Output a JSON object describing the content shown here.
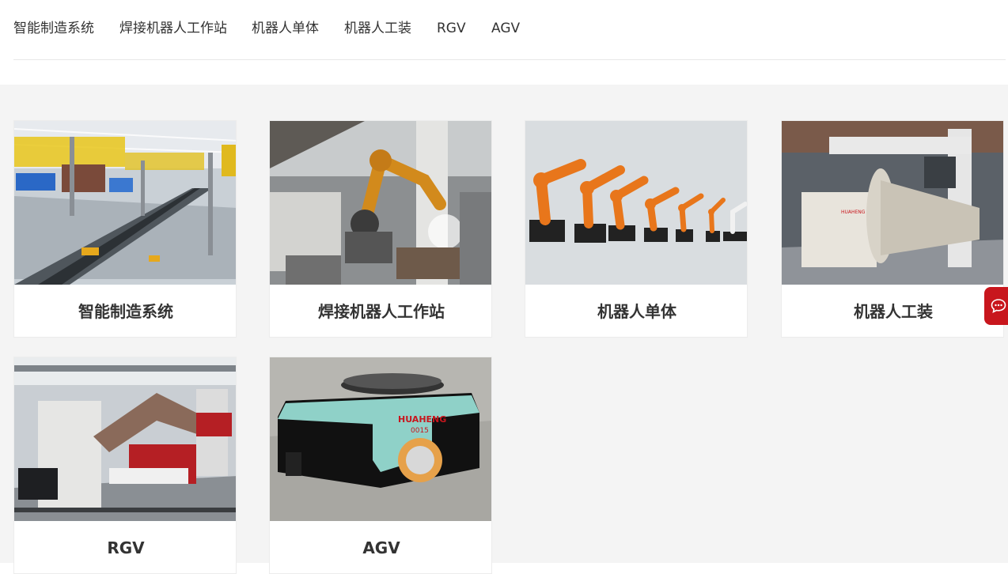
{
  "nav": {
    "items": [
      {
        "label": "智能制造系统"
      },
      {
        "label": "焊接机器人工作站"
      },
      {
        "label": "机器人单体"
      },
      {
        "label": "机器人工装"
      },
      {
        "label": "RGV"
      },
      {
        "label": "AGV"
      }
    ]
  },
  "products": [
    {
      "title": "智能制造系统",
      "image": "smart-factory-line-photo"
    },
    {
      "title": "焊接机器人工作站",
      "image": "welding-robot-workstation-photo"
    },
    {
      "title": "机器人单体",
      "image": "orange-industrial-robots-photo"
    },
    {
      "title": "机器人工装",
      "image": "robot-positioner-fixture-photo"
    },
    {
      "title": "RGV",
      "image": "rgv-rail-vehicle-photo"
    },
    {
      "title": "AGV",
      "image": "agv-vehicle-photo",
      "agv_brand": "HUAHENG",
      "agv_number": "0015"
    }
  ],
  "chat": {
    "icon": "chat-bubble-icon"
  },
  "colors": {
    "accent": "#c8161d",
    "background": "#f4f4f4",
    "text": "#333333"
  }
}
